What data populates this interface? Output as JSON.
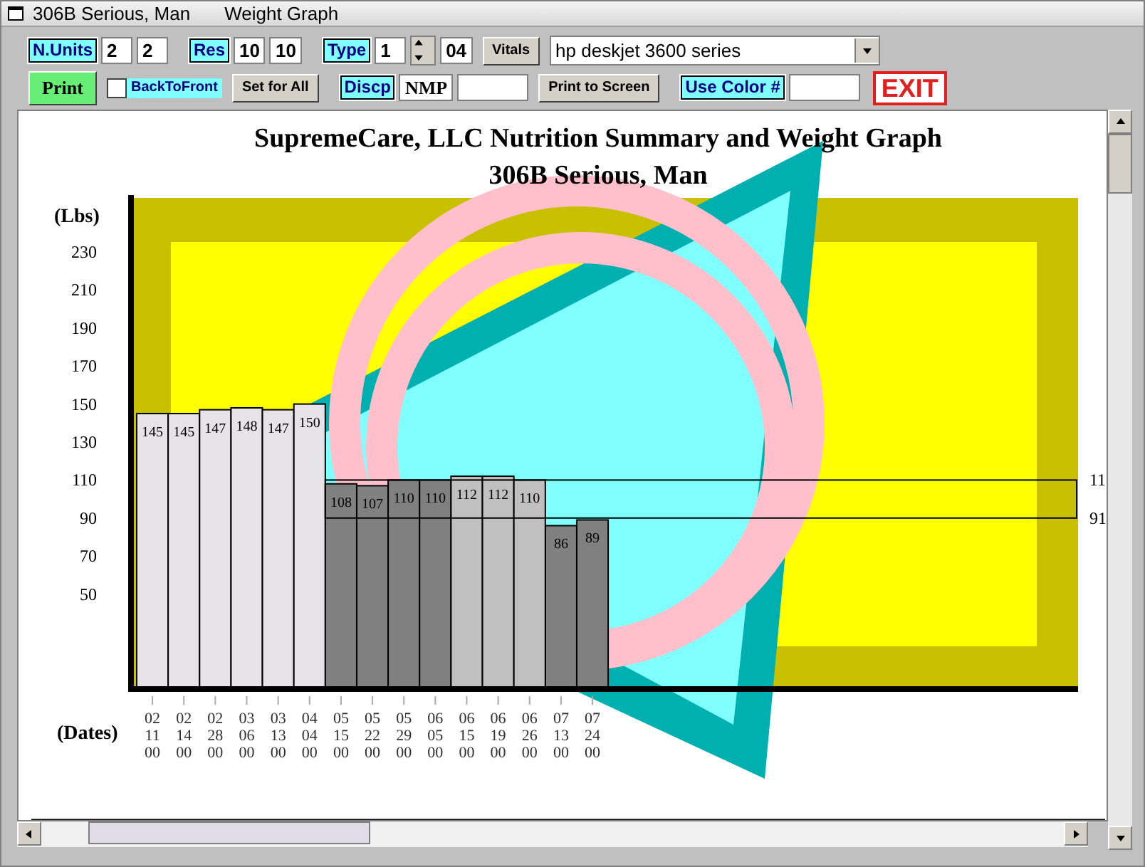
{
  "window": {
    "title": "306B Serious, Man",
    "caption": "Weight Graph"
  },
  "toolbar": {
    "upper_controls": [
      {
        "kind": "label",
        "text": "N.Units"
      },
      {
        "kind": "field",
        "value": "2"
      },
      {
        "kind": "field",
        "value": "2"
      },
      {
        "kind": "label",
        "text": "Res"
      },
      {
        "kind": "field",
        "value": "10"
      },
      {
        "kind": "field",
        "value": "10"
      },
      {
        "kind": "label",
        "text": "Type"
      },
      {
        "kind": "field",
        "value": "1"
      },
      {
        "kind": "spinner"
      },
      {
        "kind": "field",
        "value": "04"
      },
      {
        "kind": "button",
        "text": "Vitals"
      },
      {
        "kind": "dropdown",
        "value": "hp deskjet 3600 series"
      }
    ],
    "lower_controls": [
      {
        "kind": "primary-button",
        "text": "Print"
      },
      {
        "kind": "checkbox",
        "text": "BackToFront",
        "checked": false
      },
      {
        "kind": "button",
        "text": "Set for All"
      },
      {
        "kind": "label",
        "text": "Discp"
      },
      {
        "kind": "field",
        "value": "NMP"
      },
      {
        "kind": "field"
      },
      {
        "kind": "button",
        "text": "Print to Screen"
      },
      {
        "kind": "label",
        "text": "Use Color #"
      },
      {
        "kind": "field"
      },
      {
        "kind": "exit-button",
        "text": "EXIT"
      }
    ]
  },
  "chart": {
    "subtitle": "306B Serious, Man",
    "chart_data": {
      "type": "bar",
      "title": "SupremeCare, LLC Nutrition Summary and Weight Graph",
      "xlabel": "(Dates)",
      "ylabel": "(Lbs)",
      "categories": [
        "02 11 00",
        "02 14 00",
        "02 28 00",
        "03 06 00",
        "03 13 00",
        "04 04 00",
        "05 15 00",
        "05 22 00",
        "05 29 00",
        "06 05 00",
        "06 15 00",
        "06 19 00",
        "06 26 00",
        "07 13 00",
        "07 24 00"
      ],
      "series": [
        {
          "color": "#e6e4e8",
          "values": [
            145,
            145,
            147,
            148,
            147,
            150,
            null,
            null,
            null,
            null,
            null,
            null,
            null,
            null,
            null
          ]
        },
        {
          "color": "#808080",
          "values": [
            null,
            null,
            null,
            null,
            null,
            null,
            108,
            107,
            110,
            110,
            null,
            null,
            null,
            86,
            89
          ]
        },
        {
          "color": "#c0c0c0",
          "values": [
            null,
            null,
            null,
            null,
            null,
            null,
            null,
            null,
            null,
            null,
            112,
            112,
            110,
            null,
            null
          ]
        }
      ],
      "ylim": [
        0,
        260
      ],
      "yticks": [
        50,
        70,
        90,
        110,
        130,
        150,
        170,
        190,
        210,
        230
      ],
      "data_labels": true
    },
    "line_end_labels": [
      "11",
      "91"
    ]
  }
}
